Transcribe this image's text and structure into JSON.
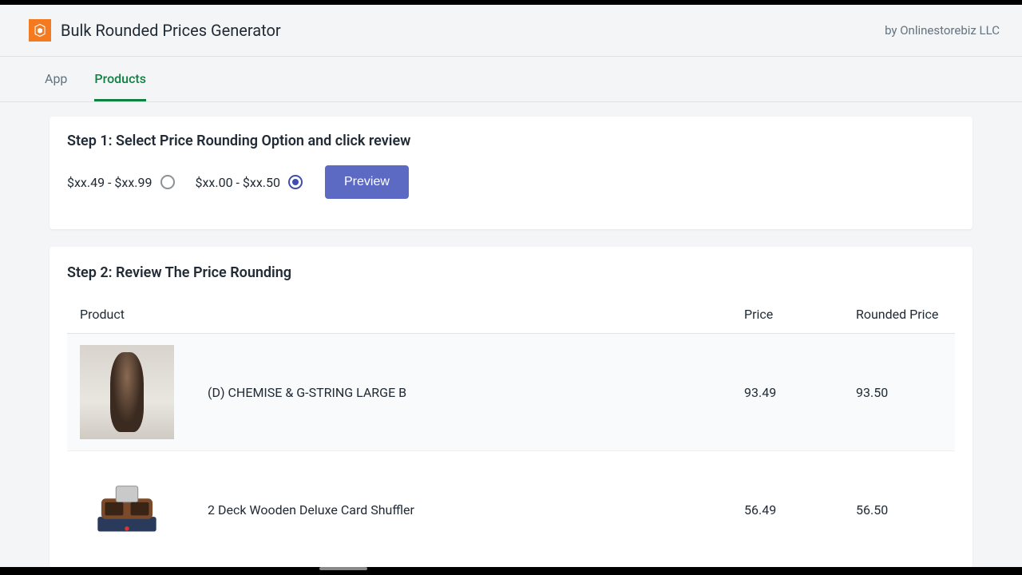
{
  "header": {
    "app_title": "Bulk Rounded Prices Generator",
    "byline": "by Onlinestorebiz LLC"
  },
  "tabs": {
    "app": "App",
    "products": "Products"
  },
  "step1": {
    "title": "Step 1: Select Price Rounding Option and click review",
    "option_a": "$xx.49 - $xx.99",
    "option_b": "$xx.00 - $xx.50",
    "preview_label": "Preview"
  },
  "step2": {
    "title": "Step 2: Review The Price Rounding",
    "columns": {
      "product": "Product",
      "price": "Price",
      "rounded": "Rounded Price"
    },
    "rows": [
      {
        "name": "(D) CHEMISE & G-STRING LARGE B",
        "price": "93.49",
        "rounded": "93.50"
      },
      {
        "name": "2 Deck Wooden Deluxe Card Shuffler",
        "price": "56.49",
        "rounded": "56.50"
      }
    ]
  }
}
